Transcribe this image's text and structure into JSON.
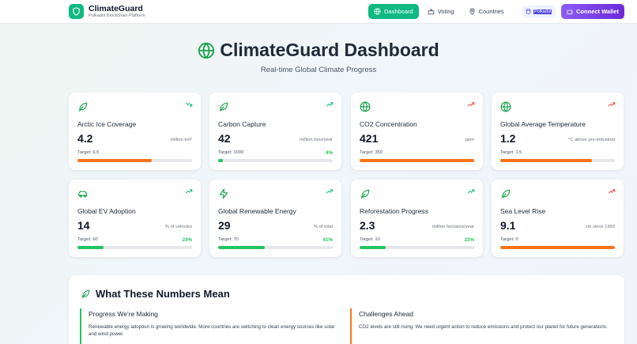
{
  "header": {
    "brand_title": "ClimateGuard",
    "brand_subtitle": "Polkadot Blockchain Platform",
    "nav": [
      {
        "label": "Dashboard",
        "icon": "globe-icon",
        "active": true
      },
      {
        "label": "Voting",
        "icon": "vote-icon",
        "active": false
      },
      {
        "label": "Countries",
        "icon": "pin-icon",
        "active": false
      }
    ],
    "network_badge": "Polkadot",
    "connect_label": "Connect Wallet"
  },
  "hero": {
    "title": "ClimateGuard Dashboard",
    "subtitle": "Real-time Global Climate Progress"
  },
  "cards": [
    {
      "label": "Arctic Ice Coverage",
      "value": "4.2",
      "unit": "million km²",
      "target": "Target: 6.5",
      "pct": "",
      "progress": 0.65,
      "icon": "leaf-icon",
      "trend": "trend-down-icon",
      "trend_color": "#10b981",
      "bar_color": "#f97316"
    },
    {
      "label": "Carbon Capture",
      "value": "42",
      "unit": "million tons/year",
      "target": "Target: 1000",
      "pct": "4%",
      "progress": 0.04,
      "icon": "leaf-icon",
      "trend": "trend-up-icon",
      "trend_color": "#10b981",
      "bar_color": "#22c55e"
    },
    {
      "label": "CO2 Concentration",
      "value": "421",
      "unit": "ppm",
      "target": "Target: 350",
      "pct": "",
      "progress": 1.0,
      "icon": "globe-icon",
      "trend": "trend-up-icon",
      "trend_color": "#ef4444",
      "bar_color": "#f97316"
    },
    {
      "label": "Global Average Temperature",
      "value": "1.2",
      "unit": "°C above pre-industrial",
      "target": "Target: 1.5",
      "pct": "",
      "progress": 0.8,
      "icon": "globe-icon",
      "trend": "trend-up-icon",
      "trend_color": "#ef4444",
      "bar_color": "#f97316"
    },
    {
      "label": "Global EV Adoption",
      "value": "14",
      "unit": "% of vehicles",
      "target": "Target: 60",
      "pct": "23%",
      "progress": 0.23,
      "icon": "car-icon",
      "trend": "trend-up-icon",
      "trend_color": "#10b981",
      "bar_color": "#22c55e"
    },
    {
      "label": "Global Renewable Energy",
      "value": "29",
      "unit": "% of total",
      "target": "Target: 70",
      "pct": "41%",
      "progress": 0.41,
      "icon": "lightning-icon",
      "trend": "trend-up-icon",
      "trend_color": "#10b981",
      "bar_color": "#22c55e"
    },
    {
      "label": "Reforestation Progress",
      "value": "2.3",
      "unit": "million hectares/year",
      "target": "Target: 10",
      "pct": "23%",
      "progress": 0.23,
      "icon": "leaf-icon",
      "trend": "trend-up-icon",
      "trend_color": "#10b981",
      "bar_color": "#22c55e"
    },
    {
      "label": "Sea Level Rise",
      "value": "9.1",
      "unit": "cm since 1993",
      "target": "Target: 0",
      "pct": "",
      "progress": 1.0,
      "icon": "leaf-icon",
      "trend": "trend-up-icon",
      "trend_color": "#ef4444",
      "bar_color": "#f97316"
    }
  ],
  "meaning": {
    "title": "What These Numbers Mean",
    "left_title": "Progress We're Making",
    "left_text": "Renewable energy adoption is growing worldwide. More countries are switching to clean energy sources like solar and wind power.",
    "right_title": "Challenges Ahead",
    "right_text": "CO2 levels are still rising. We need urgent action to reduce emissions and protect our planet for future generations."
  },
  "colors": {
    "accent": "#10b981",
    "wallet": "#7c3aed",
    "warning": "#f97316",
    "danger": "#ef4444"
  }
}
